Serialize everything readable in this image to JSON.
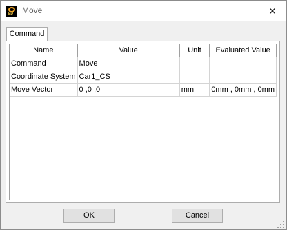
{
  "window": {
    "title": "Move",
    "icon": "app-logo-icon",
    "icon_text": "EDT",
    "close_glyph": "✕"
  },
  "tabs": [
    {
      "label": "Command"
    }
  ],
  "grid": {
    "columns": [
      "Name",
      "Value",
      "Unit",
      "Evaluated Value"
    ],
    "rows": [
      {
        "name": "Command",
        "value": "Move",
        "unit": "",
        "evaluated": ""
      },
      {
        "name": "Coordinate System",
        "value": "Car1_CS",
        "unit": "",
        "evaluated": ""
      },
      {
        "name": "Move Vector",
        "value": "0 ,0 ,0",
        "unit": "mm",
        "evaluated": "0mm , 0mm , 0mm"
      }
    ]
  },
  "buttons": {
    "ok": "OK",
    "cancel": "Cancel"
  }
}
